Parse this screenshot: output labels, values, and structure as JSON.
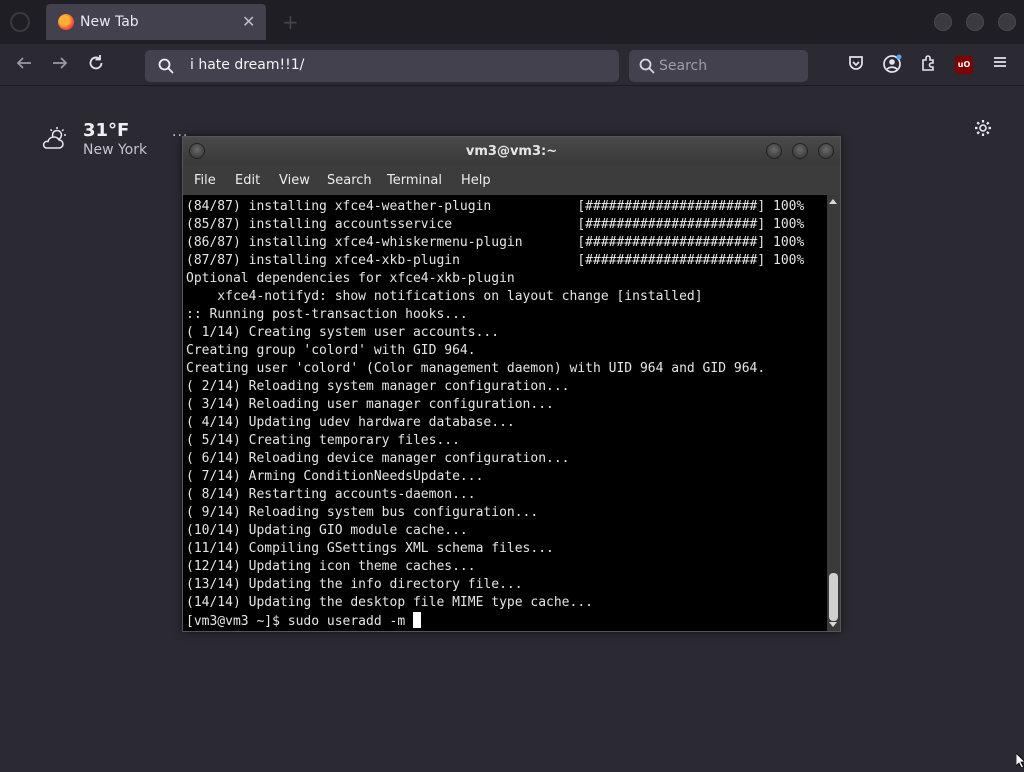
{
  "browser": {
    "tab": {
      "title": "New Tab",
      "close_glyph": "✕"
    },
    "url": {
      "value": "i hate dream!!1/"
    },
    "search": {
      "placeholder": "Search"
    },
    "icons": [
      "back-arrow-icon",
      "forward-arrow-icon",
      "reload-icon",
      "search-icon",
      "pocket-icon",
      "account-icon",
      "extensions-icon",
      "ublock-origin-icon",
      "menu-icon"
    ],
    "ublock_label": "uO"
  },
  "newtab": {
    "weather": {
      "temperature": "31°F",
      "location": "New York",
      "more": "..."
    }
  },
  "terminal": {
    "title": "vm3@vm3:~",
    "menu": [
      "File",
      "Edit",
      "View",
      "Search",
      "Terminal",
      "Help"
    ],
    "lines": [
      "(84/87) installing xfce4-weather-plugin           [######################] 100%",
      "(85/87) installing accountsservice                [######################] 100%",
      "(86/87) installing xfce4-whiskermenu-plugin       [######################] 100%",
      "(87/87) installing xfce4-xkb-plugin               [######################] 100%",
      "Optional dependencies for xfce4-xkb-plugin",
      "    xfce4-notifyd: show notifications on layout change [installed]",
      ":: Running post-transaction hooks...",
      "( 1/14) Creating system user accounts...",
      "Creating group 'colord' with GID 964.",
      "Creating user 'colord' (Color management daemon) with UID 964 and GID 964.",
      "( 2/14) Reloading system manager configuration...",
      "( 3/14) Reloading user manager configuration...",
      "( 4/14) Updating udev hardware database...",
      "( 5/14) Creating temporary files...",
      "( 6/14) Reloading device manager configuration...",
      "( 7/14) Arming ConditionNeedsUpdate...",
      "( 8/14) Restarting accounts-daemon...",
      "( 9/14) Reloading system bus configuration...",
      "(10/14) Updating GIO module cache...",
      "(11/14) Compiling GSettings XML schema files...",
      "(12/14) Updating icon theme caches...",
      "(13/14) Updating the info directory file...",
      "(14/14) Updating the desktop file MIME type cache..."
    ],
    "prompt": "[vm3@vm3 ~]$ sudo useradd -m "
  },
  "colors": {
    "page_bg": "#2b2a33",
    "toolbar_field": "#42414d",
    "terminal_bg": "#000000",
    "terminal_fg": "#e5e5e5",
    "ublock": "#800000"
  }
}
